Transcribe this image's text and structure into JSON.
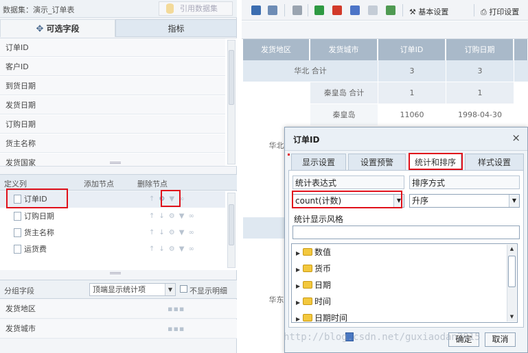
{
  "dataset": {
    "label": "数据集：演示_订单表",
    "ref_button": "引用数据集"
  },
  "left_tabs": {
    "fields": "可选字段",
    "metrics": "指标"
  },
  "fields": [
    "订单ID",
    "客户ID",
    "到货日期",
    "发货日期",
    "订购日期",
    "货主名称",
    "发货国家"
  ],
  "define": {
    "header": "定义列",
    "add_node": "添加节点",
    "delete_node": "删除节点",
    "rows": [
      "订单ID",
      "订购日期",
      "货主名称",
      "运货费"
    ]
  },
  "group": {
    "label": "分组字段",
    "select_value": "顶端显示统计项",
    "hide_detail": "不显示明细",
    "rows": [
      "发货地区",
      "发货城市"
    ],
    "dots": "▪▪▪"
  },
  "toolbar": {
    "basic_settings": "基本设置",
    "print_settings": "打印设置"
  },
  "report": {
    "headers": [
      "发货地区",
      "发货城市",
      "订单ID",
      "订购日期"
    ],
    "rows": [
      {
        "c1": "华北 合计",
        "c3": "3",
        "c4": "3"
      },
      {
        "c1": "秦皇岛 合计",
        "c3": "1",
        "c4": "1"
      },
      {
        "c1": "秦皇岛",
        "c3": "11060",
        "c4": "1998-04-30"
      }
    ],
    "region_a": "华北",
    "region_b": "华东"
  },
  "dialog": {
    "title": "订单ID",
    "close": "×",
    "tabs": [
      "显示设置",
      "设置预警",
      "统计和排序",
      "样式设置"
    ],
    "active_tab": 2,
    "stat_expr_label": "统计表达式",
    "sort_label": "排序方式",
    "stat_expr_value": "count(计数)",
    "sort_value": "升序",
    "display_style_label": "统计显示风格",
    "tree": [
      "数值",
      "货币",
      "日期",
      "时间",
      "日期时间"
    ],
    "ok": "确定",
    "cancel": "取消"
  },
  "watermark": "http://blog.csdn.net/guxiaodan2015",
  "colors": {
    "highlight": "#e0101a",
    "header_bg": "#a9b9c9"
  }
}
